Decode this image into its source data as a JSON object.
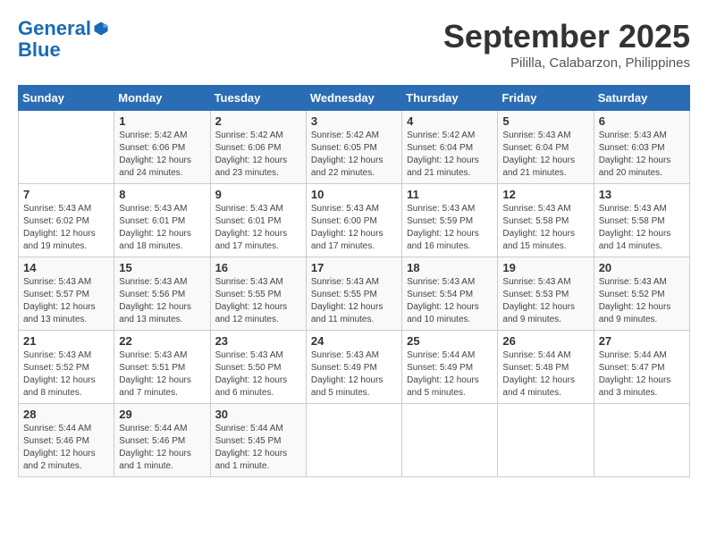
{
  "header": {
    "logo_line1": "General",
    "logo_line2": "Blue",
    "month": "September 2025",
    "location": "Pililla, Calabarzon, Philippines"
  },
  "weekdays": [
    "Sunday",
    "Monday",
    "Tuesday",
    "Wednesday",
    "Thursday",
    "Friday",
    "Saturday"
  ],
  "weeks": [
    [
      {
        "day": "",
        "info": ""
      },
      {
        "day": "1",
        "info": "Sunrise: 5:42 AM\nSunset: 6:06 PM\nDaylight: 12 hours\nand 24 minutes."
      },
      {
        "day": "2",
        "info": "Sunrise: 5:42 AM\nSunset: 6:06 PM\nDaylight: 12 hours\nand 23 minutes."
      },
      {
        "day": "3",
        "info": "Sunrise: 5:42 AM\nSunset: 6:05 PM\nDaylight: 12 hours\nand 22 minutes."
      },
      {
        "day": "4",
        "info": "Sunrise: 5:42 AM\nSunset: 6:04 PM\nDaylight: 12 hours\nand 21 minutes."
      },
      {
        "day": "5",
        "info": "Sunrise: 5:43 AM\nSunset: 6:04 PM\nDaylight: 12 hours\nand 21 minutes."
      },
      {
        "day": "6",
        "info": "Sunrise: 5:43 AM\nSunset: 6:03 PM\nDaylight: 12 hours\nand 20 minutes."
      }
    ],
    [
      {
        "day": "7",
        "info": "Sunrise: 5:43 AM\nSunset: 6:02 PM\nDaylight: 12 hours\nand 19 minutes."
      },
      {
        "day": "8",
        "info": "Sunrise: 5:43 AM\nSunset: 6:01 PM\nDaylight: 12 hours\nand 18 minutes."
      },
      {
        "day": "9",
        "info": "Sunrise: 5:43 AM\nSunset: 6:01 PM\nDaylight: 12 hours\nand 17 minutes."
      },
      {
        "day": "10",
        "info": "Sunrise: 5:43 AM\nSunset: 6:00 PM\nDaylight: 12 hours\nand 17 minutes."
      },
      {
        "day": "11",
        "info": "Sunrise: 5:43 AM\nSunset: 5:59 PM\nDaylight: 12 hours\nand 16 minutes."
      },
      {
        "day": "12",
        "info": "Sunrise: 5:43 AM\nSunset: 5:58 PM\nDaylight: 12 hours\nand 15 minutes."
      },
      {
        "day": "13",
        "info": "Sunrise: 5:43 AM\nSunset: 5:58 PM\nDaylight: 12 hours\nand 14 minutes."
      }
    ],
    [
      {
        "day": "14",
        "info": "Sunrise: 5:43 AM\nSunset: 5:57 PM\nDaylight: 12 hours\nand 13 minutes."
      },
      {
        "day": "15",
        "info": "Sunrise: 5:43 AM\nSunset: 5:56 PM\nDaylight: 12 hours\nand 13 minutes."
      },
      {
        "day": "16",
        "info": "Sunrise: 5:43 AM\nSunset: 5:55 PM\nDaylight: 12 hours\nand 12 minutes."
      },
      {
        "day": "17",
        "info": "Sunrise: 5:43 AM\nSunset: 5:55 PM\nDaylight: 12 hours\nand 11 minutes."
      },
      {
        "day": "18",
        "info": "Sunrise: 5:43 AM\nSunset: 5:54 PM\nDaylight: 12 hours\nand 10 minutes."
      },
      {
        "day": "19",
        "info": "Sunrise: 5:43 AM\nSunset: 5:53 PM\nDaylight: 12 hours\nand 9 minutes."
      },
      {
        "day": "20",
        "info": "Sunrise: 5:43 AM\nSunset: 5:52 PM\nDaylight: 12 hours\nand 9 minutes."
      }
    ],
    [
      {
        "day": "21",
        "info": "Sunrise: 5:43 AM\nSunset: 5:52 PM\nDaylight: 12 hours\nand 8 minutes."
      },
      {
        "day": "22",
        "info": "Sunrise: 5:43 AM\nSunset: 5:51 PM\nDaylight: 12 hours\nand 7 minutes."
      },
      {
        "day": "23",
        "info": "Sunrise: 5:43 AM\nSunset: 5:50 PM\nDaylight: 12 hours\nand 6 minutes."
      },
      {
        "day": "24",
        "info": "Sunrise: 5:43 AM\nSunset: 5:49 PM\nDaylight: 12 hours\nand 5 minutes."
      },
      {
        "day": "25",
        "info": "Sunrise: 5:44 AM\nSunset: 5:49 PM\nDaylight: 12 hours\nand 5 minutes."
      },
      {
        "day": "26",
        "info": "Sunrise: 5:44 AM\nSunset: 5:48 PM\nDaylight: 12 hours\nand 4 minutes."
      },
      {
        "day": "27",
        "info": "Sunrise: 5:44 AM\nSunset: 5:47 PM\nDaylight: 12 hours\nand 3 minutes."
      }
    ],
    [
      {
        "day": "28",
        "info": "Sunrise: 5:44 AM\nSunset: 5:46 PM\nDaylight: 12 hours\nand 2 minutes."
      },
      {
        "day": "29",
        "info": "Sunrise: 5:44 AM\nSunset: 5:46 PM\nDaylight: 12 hours\nand 1 minute."
      },
      {
        "day": "30",
        "info": "Sunrise: 5:44 AM\nSunset: 5:45 PM\nDaylight: 12 hours\nand 1 minute."
      },
      {
        "day": "",
        "info": ""
      },
      {
        "day": "",
        "info": ""
      },
      {
        "day": "",
        "info": ""
      },
      {
        "day": "",
        "info": ""
      }
    ]
  ]
}
